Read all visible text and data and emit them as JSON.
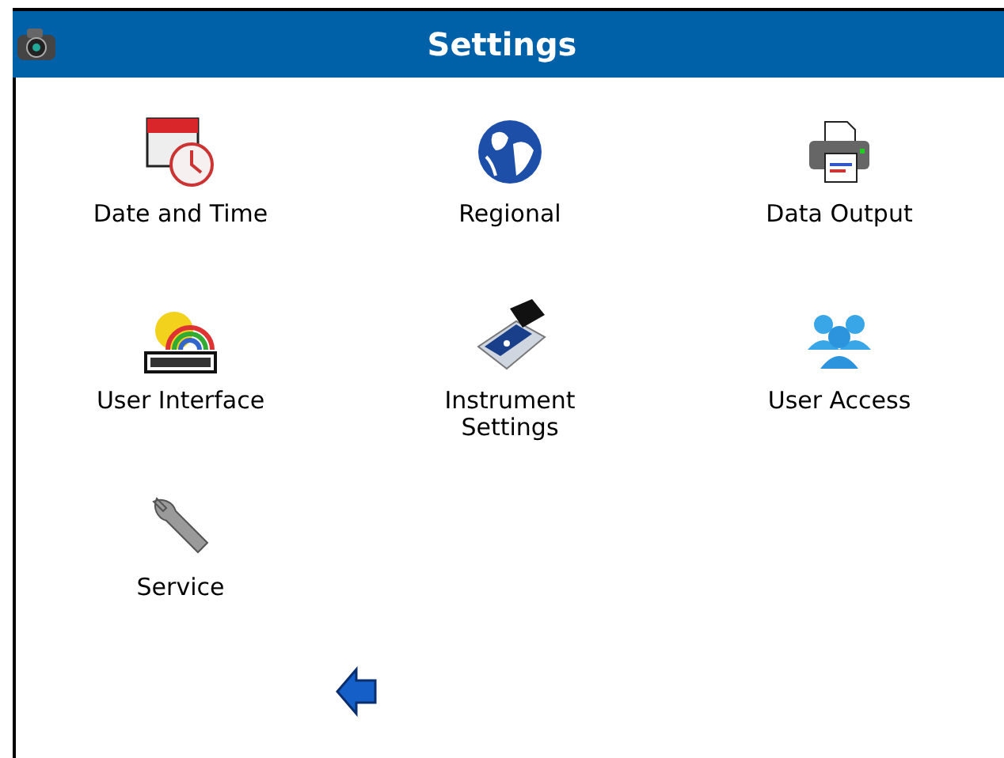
{
  "window": {
    "title": "Settings"
  },
  "items": [
    {
      "kind": "datetime",
      "label": "Date and Time"
    },
    {
      "kind": "regional",
      "label": "Regional"
    },
    {
      "kind": "output",
      "label": "Data Output"
    },
    {
      "kind": "ui",
      "label": "User Interface"
    },
    {
      "kind": "instrument",
      "label": "Instrument Settings"
    },
    {
      "kind": "access",
      "label": "User Access"
    },
    {
      "kind": "service",
      "label": "Service"
    }
  ]
}
